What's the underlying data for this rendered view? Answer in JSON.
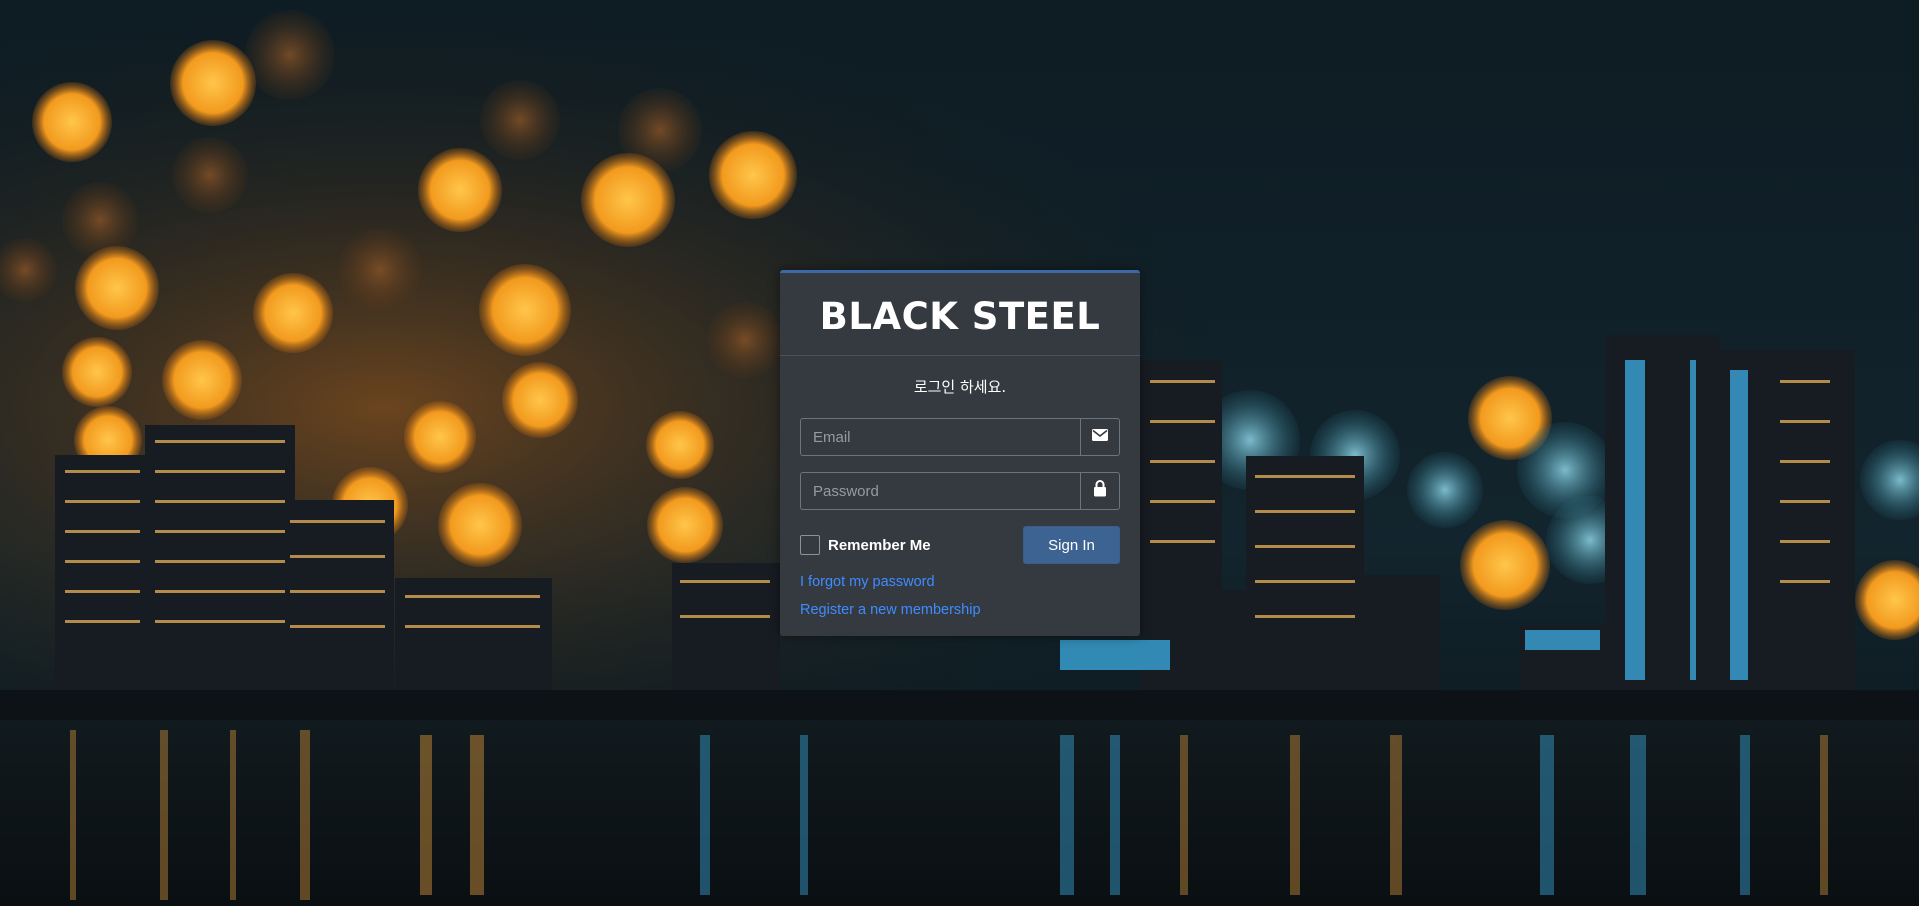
{
  "brand": {
    "title": "BLACK STEEL"
  },
  "login": {
    "message": "로그인 하세요.",
    "email_placeholder": "Email",
    "email_value": "",
    "password_placeholder": "Password",
    "password_value": "",
    "remember_label": "Remember Me",
    "remember_checked": false,
    "signin_label": "Sign In",
    "forgot_link": "I forgot my password",
    "register_link": "Register a new membership"
  },
  "icons": {
    "email": "envelope-icon",
    "password": "lock-icon"
  },
  "colors": {
    "panel": "#343a40",
    "accent": "#3d6393",
    "link": "#3f8cff",
    "text": "#ffffff"
  }
}
